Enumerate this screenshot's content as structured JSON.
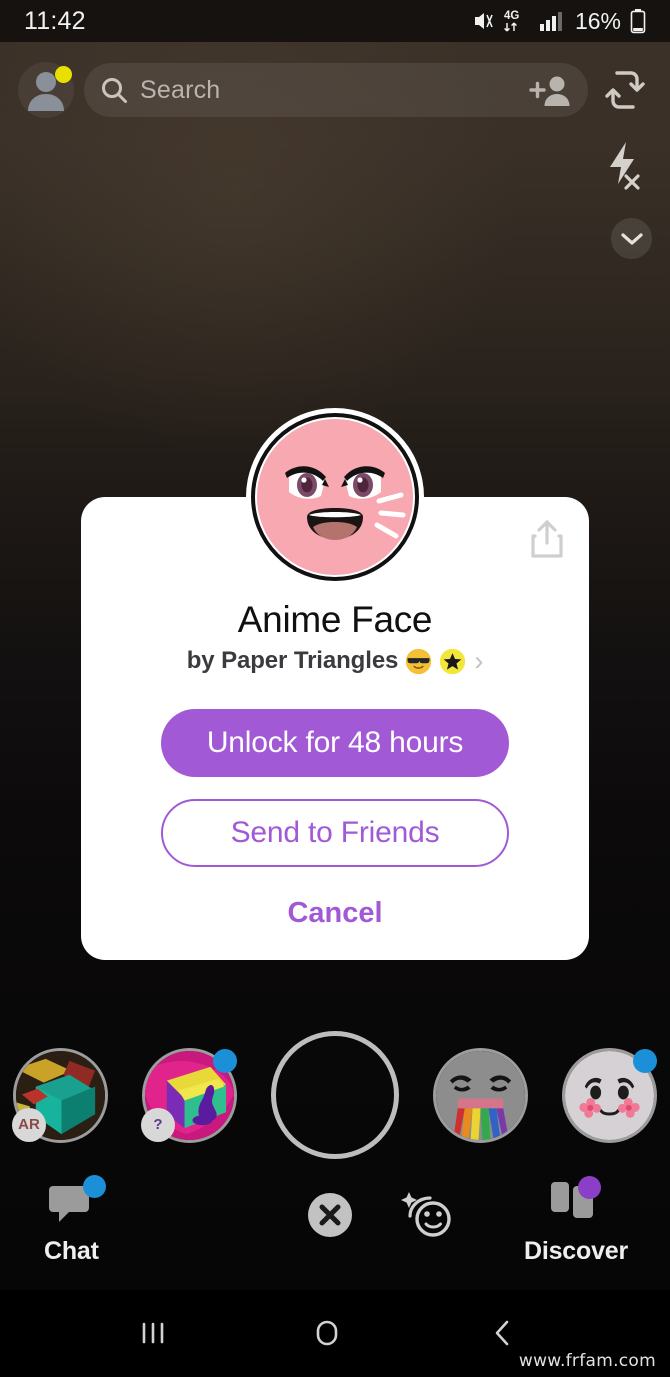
{
  "status_bar": {
    "time": "11:42",
    "battery_percent": "16%",
    "network": "4G",
    "icons": [
      "mute-icon",
      "network-4g-icon",
      "signal-bars-icon",
      "battery-icon"
    ]
  },
  "top_bar": {
    "avatar": "profile-avatar",
    "avatar_badge_color": "#e8e000",
    "search_placeholder": "Search",
    "search_icon": "search-icon",
    "add_friend_icon": "add-friend-icon",
    "camera_flip_icon": "camera-flip-icon"
  },
  "camera_controls": {
    "flash_icon": "flash-off-icon",
    "more_icon": "chevron-down-icon"
  },
  "lens_dialog": {
    "title": "Anime Face",
    "author_prefix": "by",
    "author_name": "by Paper Triangles",
    "author_badges": [
      "sunglasses-emoji",
      "star-badge"
    ],
    "chevron": "›",
    "share_icon": "share-icon",
    "unlock_label": "Unlock for 48 hours",
    "send_label": "Send to Friends",
    "cancel_label": "Cancel",
    "accent_color": "#a259d5",
    "avatar_face_color": "#f8a8b0"
  },
  "lens_carousel": {
    "items": [
      {
        "name": "ar-cube-lens",
        "badge_text": "AR",
        "has_dot": false
      },
      {
        "name": "mystery-lens",
        "badge_text": "?",
        "has_dot": true
      },
      {
        "name": "capture-button",
        "badge_text": "",
        "has_dot": false
      },
      {
        "name": "rainbow-tongue-lens",
        "badge_text": "",
        "has_dot": false
      },
      {
        "name": "cute-blush-lens",
        "badge_text": "",
        "has_dot": true
      }
    ],
    "dot_color": "#1b8fd8"
  },
  "bottom_nav": {
    "chat_label": "Chat",
    "discover_label": "Discover",
    "chat_dot_color": "#1b8fd8",
    "discover_dot_color": "#8b3fc8",
    "close_icon": "close-x-icon",
    "lens_icon": "lens-smiley-icon"
  },
  "android_nav": {
    "recents_icon": "recents-icon",
    "home_icon": "home-icon",
    "back_icon": "back-icon"
  },
  "watermark": {
    "text": "www.frfam.com"
  }
}
